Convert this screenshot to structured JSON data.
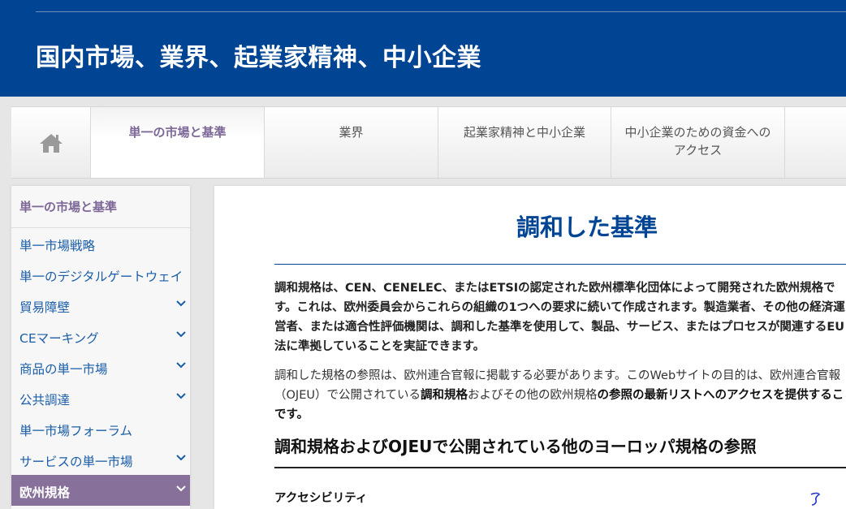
{
  "header": {
    "title": "国内市場、業界、起業家精神、中小企業"
  },
  "topnav": {
    "home_icon": "home-icon",
    "items": [
      {
        "label": "単一の市場と基準"
      },
      {
        "label": "業界"
      },
      {
        "label": "起業家精神と中小企業"
      },
      {
        "label_line1": "中小企業のための資金への",
        "label_line2": "アクセス"
      }
    ]
  },
  "sidebar": {
    "title": "単一の市場と基準",
    "items": [
      {
        "label": "単一市場戦略"
      },
      {
        "label": "単一のデジタルゲートウェイ"
      },
      {
        "label": "貿易障壁"
      },
      {
        "label": "CEマーキング"
      },
      {
        "label": "商品の単一市場"
      },
      {
        "label": "公共調達"
      },
      {
        "label": "単一市場フォーラム"
      },
      {
        "label": "サービスの単一市場"
      },
      {
        "label": "欧州規格"
      }
    ],
    "chevron_icon": "chevron-down-icon"
  },
  "main": {
    "title": "調和した基準",
    "para1": "調和規格は、CEN、CENELEC、またはETSIの認定された欧州標準化団体によって開発された欧州規格です。これは、欧州委員会からこれらの組織の1つへの要求に続いて作成されます。製造業者、その他の経済運営者、または適合性評価機関は、調和した基準を使用して、製品、サービス、またはプロセスが関連するEU法に準拠していることを実証できます。",
    "para2_a": "調和した規格の参照は、欧州連合官報に掲載する必要があります。このWebサイトの目的は、欧州連合官報（OJEU）で公開されている",
    "para2_b": "調和規格",
    "para2_c": "およびその他の欧州規格",
    "para2_d": "の参照の最新リストへのアクセスを提供することです。",
    "subheading": "調和規格およびOJEUで公開されている他のヨーロッパ規格の参照",
    "first_section": "アクセシビリティ"
  },
  "colors": {
    "header_bg": "#004494",
    "accent_purple": "#87719a",
    "link_blue": "#1a5ea8"
  }
}
